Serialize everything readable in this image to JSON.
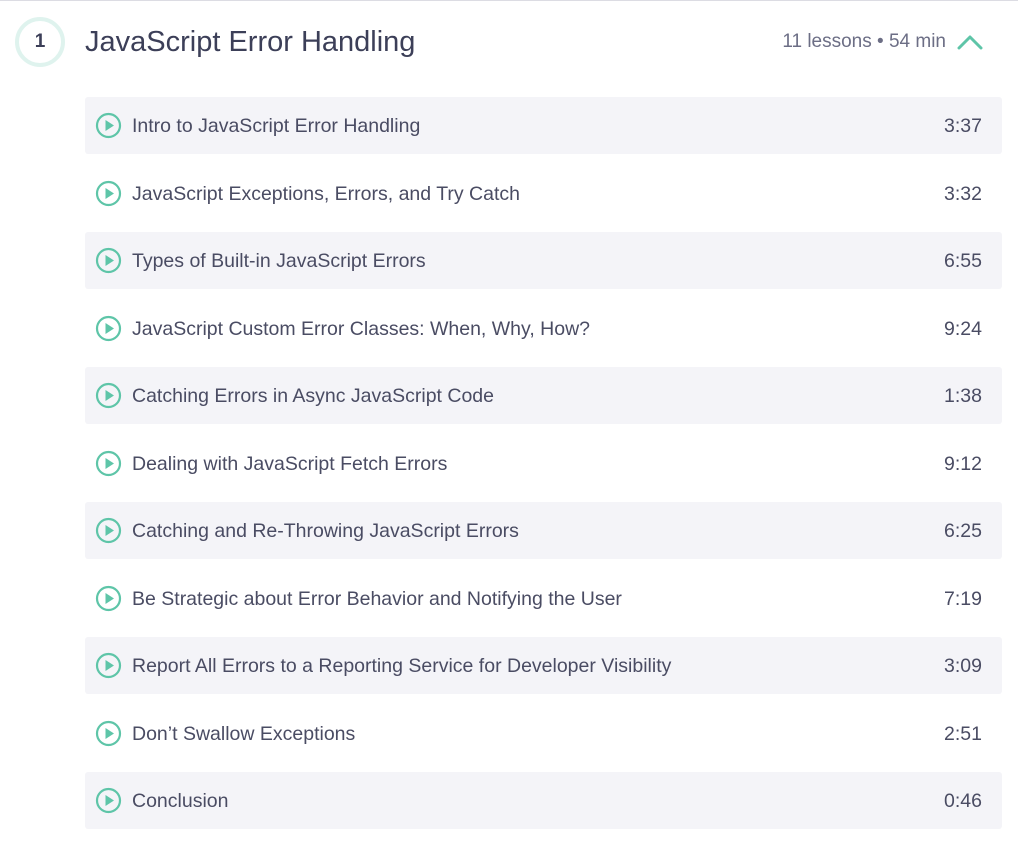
{
  "section": {
    "number": "1",
    "title": "JavaScript Error Handling",
    "meta": "11 lessons • 54 min",
    "accent_color": "#5ec5a8",
    "toggle_icon": "chevron-up-icon"
  },
  "lessons": [
    {
      "title": "Intro to JavaScript Error Handling",
      "duration": "3:37",
      "icon": "play-circle-icon"
    },
    {
      "title": "JavaScript Exceptions, Errors, and Try Catch",
      "duration": "3:32",
      "icon": "play-circle-icon"
    },
    {
      "title": "Types of Built-in JavaScript Errors",
      "duration": "6:55",
      "icon": "play-circle-icon"
    },
    {
      "title": "JavaScript Custom Error Classes: When, Why, How?",
      "duration": "9:24",
      "icon": "play-circle-icon"
    },
    {
      "title": "Catching Errors in Async JavaScript Code",
      "duration": "1:38",
      "icon": "play-circle-icon"
    },
    {
      "title": "Dealing with JavaScript Fetch Errors",
      "duration": "9:12",
      "icon": "play-circle-icon"
    },
    {
      "title": "Catching and Re-Throwing JavaScript Errors",
      "duration": "6:25",
      "icon": "play-circle-icon"
    },
    {
      "title": "Be Strategic about Error Behavior and Notifying the User",
      "duration": "7:19",
      "icon": "play-circle-icon"
    },
    {
      "title": "Report All Errors to a Reporting Service for Developer Visibility",
      "duration": "3:09",
      "icon": "play-circle-icon"
    },
    {
      "title": "Don’t Swallow Exceptions",
      "duration": "2:51",
      "icon": "play-circle-icon"
    },
    {
      "title": "Conclusion",
      "duration": "0:46",
      "icon": "play-circle-icon"
    }
  ]
}
